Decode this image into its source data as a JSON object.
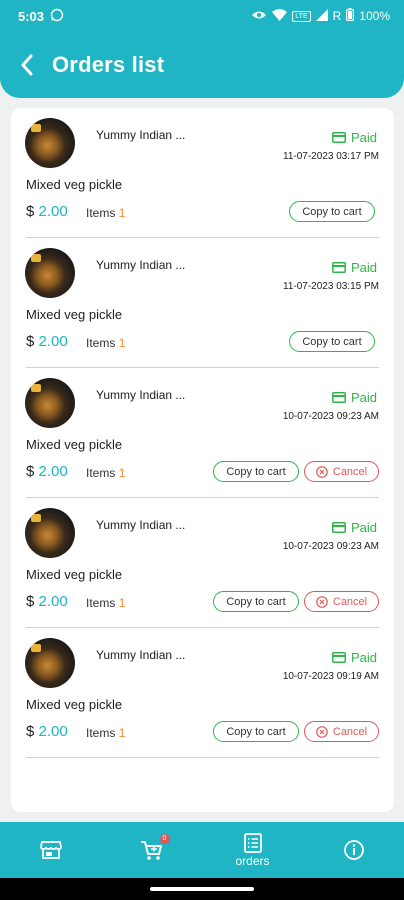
{
  "status_bar": {
    "time": "5:03",
    "battery": "100%",
    "network": "LTE",
    "signal_suffix": "R"
  },
  "header": {
    "title": "Orders list"
  },
  "orders": [
    {
      "shop": "Yummy Indian ...",
      "status": "Paid",
      "date": "11-07-2023 03:17 PM",
      "item_name": "Mixed veg pickle",
      "currency": "$",
      "amount": "2.00",
      "items_label": "Items",
      "items_count": "1",
      "copy_label": "Copy to cart",
      "cancel_label": ""
    },
    {
      "shop": "Yummy Indian ...",
      "status": "Paid",
      "date": "11-07-2023 03:15 PM",
      "item_name": "Mixed veg pickle",
      "currency": "$",
      "amount": "2.00",
      "items_label": "Items",
      "items_count": "1",
      "copy_label": "Copy to cart",
      "cancel_label": ""
    },
    {
      "shop": "Yummy Indian ...",
      "status": "Paid",
      "date": "10-07-2023 09:23 AM",
      "item_name": "Mixed veg pickle",
      "currency": "$",
      "amount": "2.00",
      "items_label": "Items",
      "items_count": "1",
      "copy_label": "Copy to cart",
      "cancel_label": "Cancel"
    },
    {
      "shop": "Yummy Indian ...",
      "status": "Paid",
      "date": "10-07-2023 09:23 AM",
      "item_name": "Mixed veg pickle",
      "currency": "$",
      "amount": "2.00",
      "items_label": "Items",
      "items_count": "1",
      "copy_label": "Copy to cart",
      "cancel_label": "Cancel"
    },
    {
      "shop": "Yummy Indian ...",
      "status": "Paid",
      "date": "10-07-2023 09:19 AM",
      "item_name": "Mixed veg pickle",
      "currency": "$",
      "amount": "2.00",
      "items_label": "Items",
      "items_count": "1",
      "copy_label": "Copy to cart",
      "cancel_label": "Cancel"
    }
  ],
  "bottom_nav": {
    "items": [
      {
        "icon": "store-icon",
        "label": ""
      },
      {
        "icon": "cart-icon",
        "label": "",
        "badge": "0"
      },
      {
        "icon": "orders-icon",
        "label": "orders"
      },
      {
        "icon": "info-icon",
        "label": ""
      }
    ]
  },
  "colors": {
    "primary": "#1fb5c4",
    "paid": "#2fb54a",
    "cancel": "#e05757",
    "count": "#f08a2c"
  }
}
